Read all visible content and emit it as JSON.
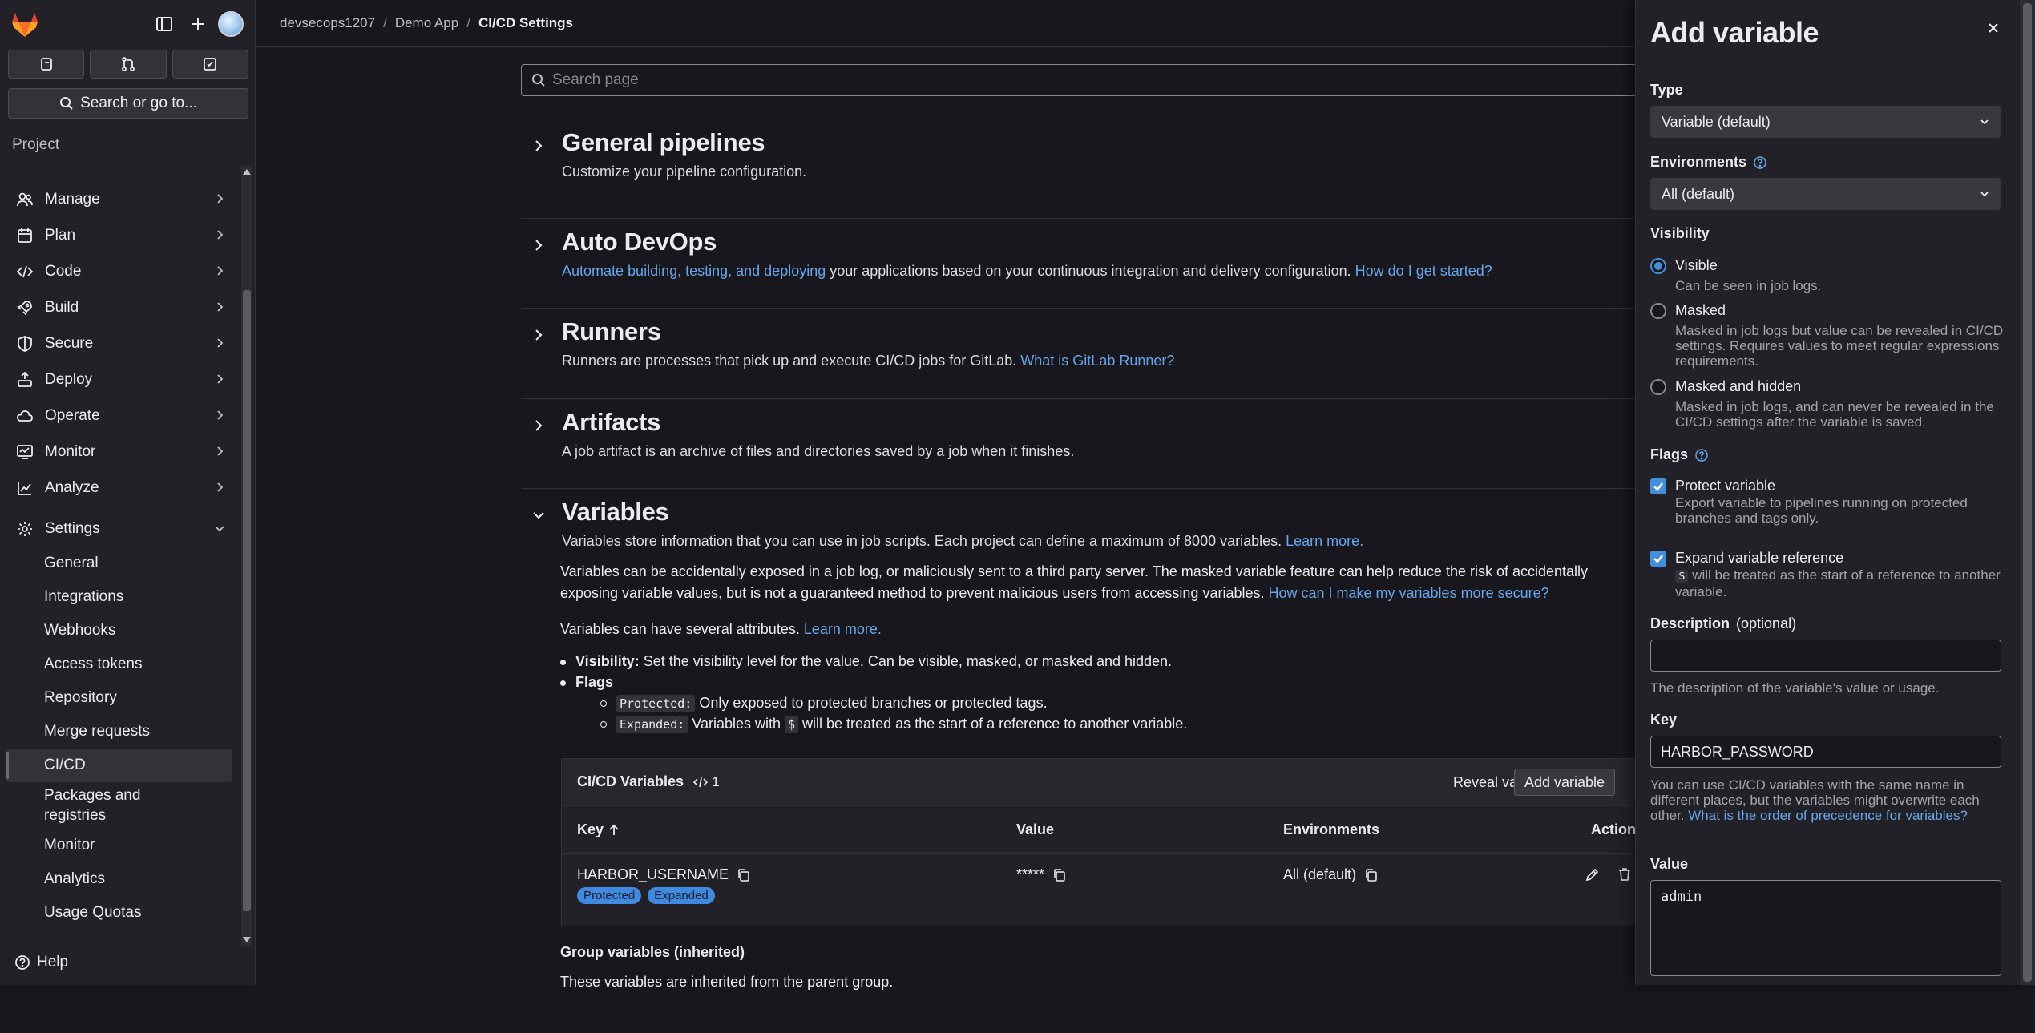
{
  "sidebar": {
    "search_label": "Search or go to...",
    "section_label": "Project",
    "items": [
      {
        "label": "Manage",
        "icon": "users-icon"
      },
      {
        "label": "Plan",
        "icon": "calendar-icon"
      },
      {
        "label": "Code",
        "icon": "code-icon"
      },
      {
        "label": "Build",
        "icon": "rocket-icon"
      },
      {
        "label": "Secure",
        "icon": "shield-icon"
      },
      {
        "label": "Deploy",
        "icon": "deploy-icon"
      },
      {
        "label": "Operate",
        "icon": "cloud-icon"
      },
      {
        "label": "Monitor",
        "icon": "monitor-icon"
      },
      {
        "label": "Analyze",
        "icon": "chart-icon"
      },
      {
        "label": "Settings",
        "icon": "gear-icon"
      }
    ],
    "settings_sub": [
      "General",
      "Integrations",
      "Webhooks",
      "Access tokens",
      "Repository",
      "Merge requests",
      "CI/CD",
      "Packages and registries",
      "Monitor",
      "Analytics",
      "Usage Quotas"
    ],
    "help_label": "Help"
  },
  "breadcrumb": {
    "group": "devsecops1207",
    "project": "Demo App",
    "current": "CI/CD Settings"
  },
  "main": {
    "search_placeholder": "Search page",
    "general": {
      "title": "General pipelines",
      "desc": "Customize your pipeline configuration."
    },
    "autodevops": {
      "title": "Auto DevOps",
      "link1": "Automate building, testing, and deploying",
      "text": " your applications based on your continuous integration and delivery configuration. ",
      "link2": "How do I get started?"
    },
    "runners": {
      "title": "Runners",
      "text": "Runners are processes that pick up and execute CI/CD jobs for GitLab. ",
      "link": "What is GitLab Runner?"
    },
    "artifacts": {
      "title": "Artifacts",
      "desc": "A job artifact is an archive of files and directories saved by a job when it finishes."
    },
    "variables": {
      "title": "Variables",
      "desc": "Variables store information that you can use in job scripts. Each project can define a maximum of 8000 variables. ",
      "desc_link": "Learn more.",
      "warn_line1": "Variables can be accidentally exposed in a job log, or maliciously sent to a third party server. The masked variable feature can help reduce the risk of accidentally",
      "warn_line2": "exposing variable values, but is not a guaranteed method to prevent malicious users from accessing variables. ",
      "warn_link": "How can I make my variables more secure?",
      "attrs": "Variables can have several attributes. ",
      "attrs_link": "Learn more.",
      "visibility_label": "Visibility:",
      "visibility_text": " Set the visibility level for the value. Can be visible, masked, or masked and hidden.",
      "flags_label": "Flags",
      "protected_code": "Protected:",
      "protected_text": " Only exposed to protected branches or protected tags.",
      "expanded_code": "Expanded:",
      "expanded_text_a": " Variables with ",
      "dollar": "$",
      "expanded_text_b": " will be treated as the start of a reference to another variable."
    },
    "table": {
      "title": "CI/CD Variables",
      "count": "1",
      "reveal_label": "Reveal values",
      "add_label": "Add variable",
      "col_key": "Key",
      "col_value": "Value",
      "col_env": "Environments",
      "col_actions": "Actions",
      "rows": [
        {
          "key": "HARBOR_USERNAME",
          "value": "*****",
          "env": "All (default)",
          "badges": [
            "Protected",
            "Expanded"
          ]
        }
      ]
    },
    "group_title": "Group variables (inherited)",
    "group_desc": "These variables are inherited from the parent group."
  },
  "drawer": {
    "title": "Add variable",
    "type_label": "Type",
    "type_value": "Variable (default)",
    "env_label": "Environments",
    "env_value": "All (default)",
    "visibility_label": "Visibility",
    "vis_options": [
      {
        "title": "Visible",
        "help": "Can be seen in job logs.",
        "selected": true
      },
      {
        "title": "Masked",
        "help": "Masked in job logs but value can be revealed in CI/CD settings. Requires values to meet regular expressions requirements.",
        "selected": false
      },
      {
        "title": "Masked and hidden",
        "help": "Masked in job logs, and can never be revealed in the CI/CD settings after the variable is saved.",
        "selected": false
      }
    ],
    "flags_label": "Flags",
    "protect_title": "Protect variable",
    "protect_help": "Export variable to pipelines running on protected branches and tags only.",
    "expand_title": "Expand variable reference",
    "expand_dollar": "$",
    "expand_help": " will be treated as the start of a reference to another variable.",
    "desc_label": "Description",
    "desc_optional": "(optional)",
    "desc_help": "The description of the variable's value or usage.",
    "key_label": "Key",
    "key_value": "HARBOR_PASSWORD",
    "key_help": "You can use CI/CD variables with the same name in different places, but the variables might overwrite each other. ",
    "key_help_link": "What is the order of precedence for variables?",
    "value_label": "Value",
    "value_value": "admin"
  },
  "colors": {
    "accent": "#428fdc",
    "link": "#63a6e9",
    "badge": "#3d8ae0",
    "bg": "#18171d",
    "panel": "#232128"
  }
}
